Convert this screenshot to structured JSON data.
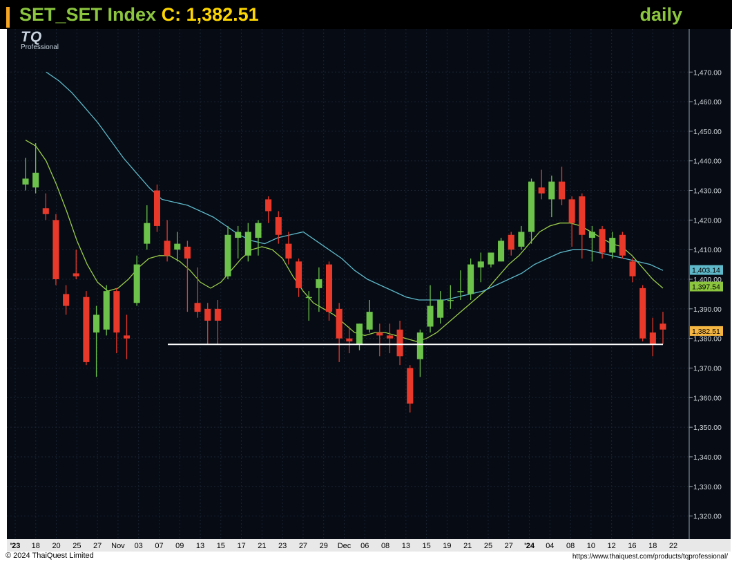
{
  "header": {
    "symbol": "SET_SET Index",
    "close_label": "C: 1,382.51",
    "period": "daily"
  },
  "logo": {
    "mark": "TQ",
    "sub": "Professional"
  },
  "footer": {
    "copyright": "© 2024 ThaiQuest Limited",
    "url": "https://www.thaiquest.com/products/tqprofessional/"
  },
  "colors": {
    "background": "#060b14",
    "up": "#6cc24a",
    "down": "#e8392b",
    "ma_short": "#9ccc4a",
    "ma_long": "#5fb8c9",
    "support_line": "#ffffff",
    "last_price_tag": "#f5b642",
    "ma_long_tag": "#5fb8c9",
    "ma_short_tag": "#8cc63f"
  },
  "chart_data": {
    "type": "candlestick",
    "ylim": [
      1315,
      1478
    ],
    "y_ticks": [
      "1,470.00",
      "1,460.00",
      "1,450.00",
      "1,440.00",
      "1,430.00",
      "1,420.00",
      "1,410.00",
      "1,400.00",
      "1,390.00",
      "1,380.00",
      "1,370.00",
      "1,360.00",
      "1,350.00",
      "1,340.00",
      "1,330.00",
      "1,320.00"
    ],
    "x_ticks": [
      "'23",
      "18",
      "20",
      "25",
      "27",
      "Nov",
      "03",
      "07",
      "09",
      "13",
      "15",
      "17",
      "21",
      "23",
      "27",
      "29",
      "Dec",
      "06",
      "08",
      "13",
      "15",
      "19",
      "21",
      "25",
      "27",
      "'24",
      "04",
      "08",
      "10",
      "12",
      "16",
      "18",
      "22"
    ],
    "candles": [
      {
        "o": 1432,
        "h": 1441,
        "l": 1430,
        "c": 1434
      },
      {
        "o": 1431,
        "h": 1446,
        "l": 1429,
        "c": 1436
      },
      {
        "o": 1424,
        "h": 1429,
        "l": 1420,
        "c": 1422
      },
      {
        "o": 1420,
        "h": 1422,
        "l": 1398,
        "c": 1400
      },
      {
        "o": 1395,
        "h": 1398,
        "l": 1388,
        "c": 1391
      },
      {
        "o": 1402,
        "h": 1410,
        "l": 1400,
        "c": 1401
      },
      {
        "o": 1394,
        "h": 1396,
        "l": 1371,
        "c": 1372
      },
      {
        "o": 1382,
        "h": 1391,
        "l": 1367,
        "c": 1388
      },
      {
        "o": 1383,
        "h": 1398,
        "l": 1381,
        "c": 1396
      },
      {
        "o": 1396,
        "h": 1397,
        "l": 1375,
        "c": 1382
      },
      {
        "o": 1381,
        "h": 1388,
        "l": 1373,
        "c": 1380
      },
      {
        "o": 1392,
        "h": 1408,
        "l": 1391,
        "c": 1405
      },
      {
        "o": 1412,
        "h": 1425,
        "l": 1410,
        "c": 1419
      },
      {
        "o": 1430,
        "h": 1432,
        "l": 1416,
        "c": 1418
      },
      {
        "o": 1413,
        "h": 1420,
        "l": 1406,
        "c": 1408
      },
      {
        "o": 1410,
        "h": 1416,
        "l": 1406,
        "c": 1412
      },
      {
        "o": 1411,
        "h": 1413,
        "l": 1389,
        "c": 1407
      },
      {
        "o": 1392,
        "h": 1404,
        "l": 1387,
        "c": 1389
      },
      {
        "o": 1390,
        "h": 1392,
        "l": 1378,
        "c": 1386
      },
      {
        "o": 1390,
        "h": 1393,
        "l": 1378,
        "c": 1386
      },
      {
        "o": 1401,
        "h": 1418,
        "l": 1400,
        "c": 1415
      },
      {
        "o": 1414,
        "h": 1418,
        "l": 1407,
        "c": 1416
      },
      {
        "o": 1408,
        "h": 1419,
        "l": 1406,
        "c": 1416
      },
      {
        "o": 1414,
        "h": 1420,
        "l": 1408,
        "c": 1419
      },
      {
        "o": 1427,
        "h": 1428,
        "l": 1419,
        "c": 1423
      },
      {
        "o": 1421,
        "h": 1423,
        "l": 1412,
        "c": 1415
      },
      {
        "o": 1412,
        "h": 1416,
        "l": 1405,
        "c": 1407
      },
      {
        "o": 1406,
        "h": 1407,
        "l": 1394,
        "c": 1397
      },
      {
        "o": 1394,
        "h": 1396,
        "l": 1386,
        "c": 1394
      },
      {
        "o": 1397,
        "h": 1404,
        "l": 1389,
        "c": 1400
      },
      {
        "o": 1405,
        "h": 1406,
        "l": 1386,
        "c": 1389
      },
      {
        "o": 1390,
        "h": 1392,
        "l": 1372,
        "c": 1380
      },
      {
        "o": 1380,
        "h": 1384,
        "l": 1375,
        "c": 1379
      },
      {
        "o": 1378,
        "h": 1385,
        "l": 1376,
        "c": 1385
      },
      {
        "o": 1383,
        "h": 1393,
        "l": 1382,
        "c": 1389
      },
      {
        "o": 1382,
        "h": 1385,
        "l": 1374,
        "c": 1381
      },
      {
        "o": 1381,
        "h": 1385,
        "l": 1375,
        "c": 1380
      },
      {
        "o": 1383,
        "h": 1386,
        "l": 1371,
        "c": 1374
      },
      {
        "o": 1370,
        "h": 1371,
        "l": 1355,
        "c": 1358
      },
      {
        "o": 1373,
        "h": 1383,
        "l": 1367,
        "c": 1382
      },
      {
        "o": 1384,
        "h": 1398,
        "l": 1382,
        "c": 1391
      },
      {
        "o": 1387,
        "h": 1396,
        "l": 1385,
        "c": 1393
      },
      {
        "o": 1393,
        "h": 1398,
        "l": 1390,
        "c": 1393
      },
      {
        "o": 1396,
        "h": 1403,
        "l": 1393,
        "c": 1396
      },
      {
        "o": 1395,
        "h": 1407,
        "l": 1393,
        "c": 1405
      },
      {
        "o": 1404,
        "h": 1409,
        "l": 1399,
        "c": 1406
      },
      {
        "o": 1405,
        "h": 1409,
        "l": 1404,
        "c": 1409
      },
      {
        "o": 1406,
        "h": 1414,
        "l": 1406,
        "c": 1413
      },
      {
        "o": 1415,
        "h": 1416,
        "l": 1408,
        "c": 1410
      },
      {
        "o": 1411,
        "h": 1418,
        "l": 1410,
        "c": 1416
      },
      {
        "o": 1416,
        "h": 1434,
        "l": 1412,
        "c": 1433
      },
      {
        "o": 1431,
        "h": 1437,
        "l": 1427,
        "c": 1429
      },
      {
        "o": 1427,
        "h": 1435,
        "l": 1421,
        "c": 1433
      },
      {
        "o": 1433,
        "h": 1438,
        "l": 1425,
        "c": 1427
      },
      {
        "o": 1427,
        "h": 1428,
        "l": 1411,
        "c": 1419
      },
      {
        "o": 1428,
        "h": 1429,
        "l": 1407,
        "c": 1415
      },
      {
        "o": 1414,
        "h": 1418,
        "l": 1406,
        "c": 1416
      },
      {
        "o": 1417,
        "h": 1418,
        "l": 1407,
        "c": 1409
      },
      {
        "o": 1409,
        "h": 1416,
        "l": 1407,
        "c": 1414
      },
      {
        "o": 1415,
        "h": 1416,
        "l": 1407,
        "c": 1408
      },
      {
        "o": 1406,
        "h": 1407,
        "l": 1399,
        "c": 1401
      },
      {
        "o": 1397,
        "h": 1398,
        "l": 1379,
        "c": 1380
      },
      {
        "o": 1382,
        "h": 1387,
        "l": 1374,
        "c": 1378
      },
      {
        "o": 1385,
        "h": 1389,
        "l": 1378,
        "c": 1383
      }
    ],
    "ma_short": [
      1447,
      1445,
      1440,
      1432,
      1423,
      1413,
      1405,
      1399,
      1396,
      1397,
      1400,
      1404,
      1407,
      1408,
      1408,
      1406,
      1403,
      1399,
      1397,
      1399,
      1403,
      1407,
      1410,
      1411,
      1410,
      1407,
      1401,
      1396,
      1392,
      1390,
      1388,
      1385,
      1382,
      1381,
      1382,
      1382,
      1381,
      1380,
      1379,
      1380,
      1382,
      1385,
      1388,
      1391,
      1394,
      1397,
      1401,
      1405,
      1408,
      1412,
      1416,
      1418,
      1419,
      1419,
      1418,
      1416,
      1414,
      1412,
      1411,
      1408,
      1404,
      1400,
      1397
    ],
    "ma_long": [
      1470,
      1467,
      1463,
      1458,
      1453,
      1447,
      1441,
      1436,
      1431,
      1427,
      1426,
      1425,
      1423,
      1421,
      1418,
      1415,
      1413,
      1412,
      1414,
      1415,
      1416,
      1413,
      1410,
      1407,
      1403,
      1400,
      1398,
      1396,
      1394,
      1393,
      1393,
      1393,
      1394,
      1395,
      1396,
      1398,
      1400,
      1402,
      1405,
      1407,
      1409,
      1410,
      1410,
      1409,
      1408,
      1407,
      1406,
      1405,
      1403
    ],
    "ma_long_start": 1,
    "ma_long_step": 1.33,
    "support_line": {
      "value": 1378,
      "from_index": 14,
      "to_index": 63
    },
    "tags": {
      "ma_long": "1,403.14",
      "ma_short": "1,397.54",
      "last": "1,382.51"
    }
  }
}
